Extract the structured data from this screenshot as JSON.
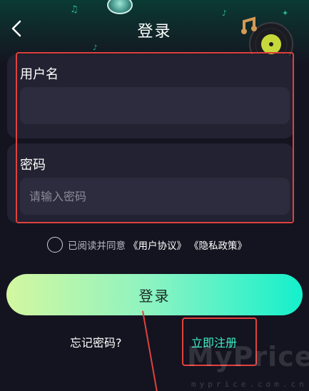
{
  "header": {
    "title": "登录",
    "back_icon": "chevron-left-icon"
  },
  "form": {
    "username": {
      "label": "用户名",
      "value": "",
      "placeholder": ""
    },
    "password": {
      "label": "密码",
      "value": "",
      "placeholder": "请输入密码"
    }
  },
  "agreement": {
    "text": "已阅读并同意",
    "user_agreement": "《用户协议》",
    "privacy_policy": "《隐私政策》",
    "checked": false
  },
  "actions": {
    "login_label": "登录",
    "forgot_label": "忘记密码?",
    "register_label": "立即注册"
  },
  "watermark": {
    "main": "MyPrice",
    "sub": "myprice.com.cn"
  },
  "colors": {
    "background": "#141420",
    "card": "#222232",
    "input": "#2c2c3e",
    "accent": "#3ef0c8",
    "highlight_outline": "#e0413c"
  }
}
